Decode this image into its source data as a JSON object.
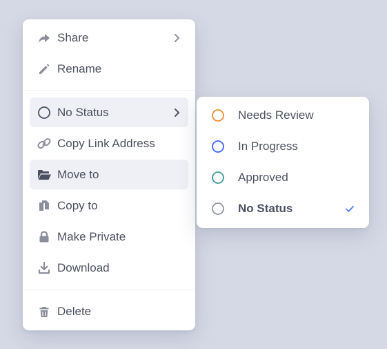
{
  "colors": {
    "backdrop": "#d5d9e5",
    "menu_bg": "#ffffff",
    "active_bg": "#eff0f5",
    "text": "#4b5160",
    "icon": "#8b8f9b",
    "check": "#4e7cf6",
    "status_needs_review": "#f28b2e",
    "status_in_progress": "#3867f3",
    "status_approved": "#3d9c9a",
    "status_none": "#8f94a0"
  },
  "main_menu": {
    "items": [
      {
        "label": "Share",
        "icon": "share-icon",
        "has_submenu": true,
        "active": false
      },
      {
        "label": "Rename",
        "icon": "pencil-icon",
        "has_submenu": false,
        "active": false
      },
      {
        "label": "No Status",
        "icon": "status-circle-icon",
        "has_submenu": true,
        "active": true
      },
      {
        "label": "Copy Link Address",
        "icon": "link-icon",
        "has_submenu": false,
        "active": false
      },
      {
        "label": "Move to",
        "icon": "folder-icon",
        "has_submenu": false,
        "active": true
      },
      {
        "label": "Copy to",
        "icon": "copy-icon",
        "has_submenu": false,
        "active": false
      },
      {
        "label": "Make Private",
        "icon": "lock-icon",
        "has_submenu": false,
        "active": false
      },
      {
        "label": "Download",
        "icon": "download-icon",
        "has_submenu": false,
        "active": false
      },
      {
        "label": "Delete",
        "icon": "trash-icon",
        "has_submenu": false,
        "active": false
      }
    ]
  },
  "status_menu": {
    "items": [
      {
        "label": "Needs Review",
        "icon": "status-circle-orange-icon",
        "selected": false
      },
      {
        "label": "In Progress",
        "icon": "status-circle-blue-icon",
        "selected": false
      },
      {
        "label": "Approved",
        "icon": "status-circle-teal-icon",
        "selected": false
      },
      {
        "label": "No Status",
        "icon": "status-circle-gray-icon",
        "selected": true
      }
    ]
  }
}
